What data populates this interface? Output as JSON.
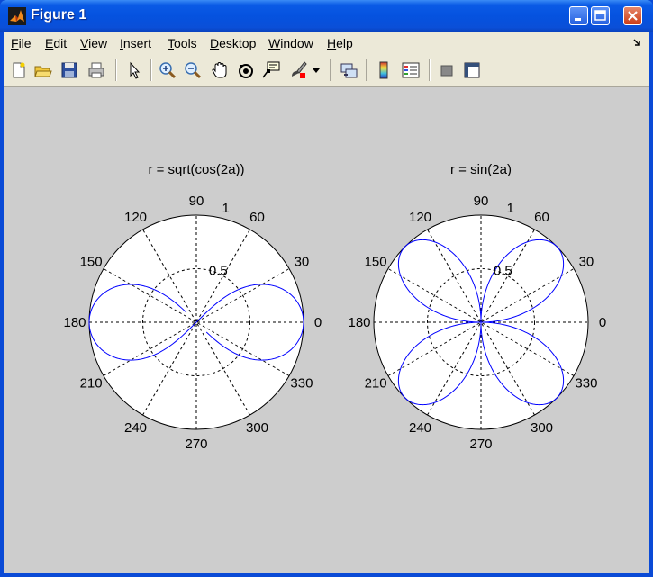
{
  "window": {
    "title": "Figure 1",
    "menu": [
      "File",
      "Edit",
      "View",
      "Insert",
      "Tools",
      "Desktop",
      "Window",
      "Help"
    ],
    "menu_mnemonic_index": [
      0,
      0,
      0,
      0,
      0,
      0,
      0,
      0
    ],
    "toolbar_icons": [
      "new-figure-icon",
      "open-file-icon",
      "save-icon",
      "print-icon",
      "edit-plot-arrow-icon",
      "zoom-in-icon",
      "zoom-out-icon",
      "pan-hand-icon",
      "rotate-3d-icon",
      "data-cursor-icon",
      "brush-icon",
      "link-plot-icon",
      "colorbar-icon",
      "legend-icon",
      "hide-plot-tools-icon",
      "show-plot-tools-icon"
    ]
  },
  "colors": {
    "curve": "#0000ff",
    "axes_bg": "#ffffff",
    "figure_bg": "#cdcdcd"
  },
  "chart_data": [
    {
      "type": "polar",
      "title": "r = sqrt(cos(2a))",
      "function": "sqrt(cos(2a))",
      "rmax": 1,
      "r_ticks": [
        "0.5",
        "1"
      ],
      "r_tick_values": [
        0.5,
        1
      ],
      "theta_ticks": [
        "0",
        "30",
        "60",
        "90",
        "120",
        "150",
        "180",
        "210",
        "240",
        "270",
        "300",
        "330"
      ],
      "series": [
        {
          "color": "#0000ff"
        }
      ]
    },
    {
      "type": "polar",
      "title": "r = sin(2a)",
      "function": "sin(2a)",
      "rmax": 1,
      "r_ticks": [
        "0.5",
        "1"
      ],
      "r_tick_values": [
        0.5,
        1
      ],
      "theta_ticks": [
        "0",
        "30",
        "60",
        "90",
        "120",
        "150",
        "180",
        "210",
        "240",
        "270",
        "300",
        "330"
      ],
      "series": [
        {
          "color": "#0000ff"
        }
      ]
    }
  ]
}
